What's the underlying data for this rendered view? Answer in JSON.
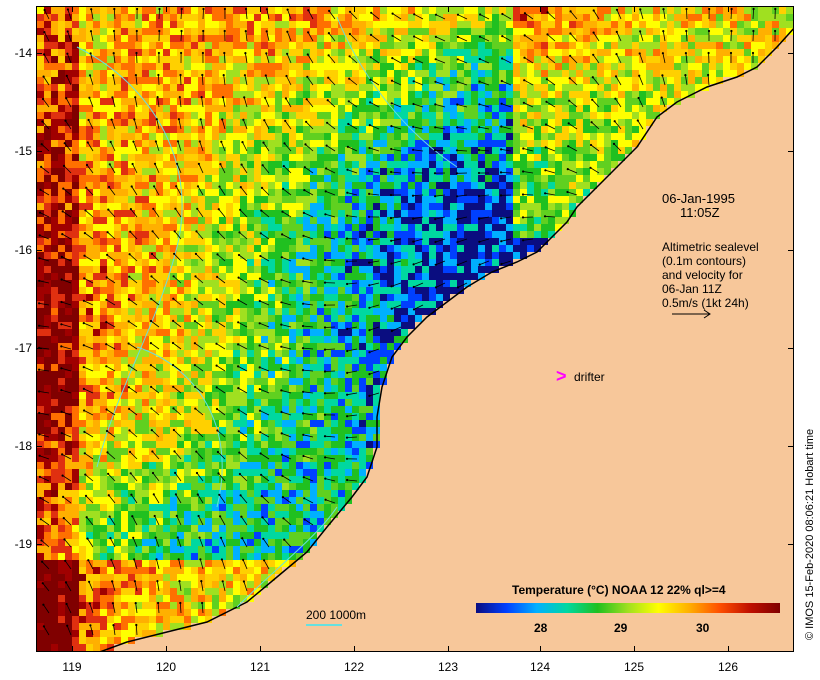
{
  "map": {
    "lat_ticks": [
      "-14",
      "-15",
      "-16",
      "-17",
      "-18",
      "-19"
    ],
    "lon_ticks": [
      "119",
      "120",
      "121",
      "122",
      "123",
      "124",
      "125",
      "126"
    ]
  },
  "annotations": {
    "date": "06-Jan-1995",
    "time": "11:05Z",
    "altimetry_lines": [
      "Altimetric sealevel",
      "(0.1m contours)",
      "and velocity for",
      "06-Jan 11Z",
      "0.5m/s (1kt 24h)"
    ],
    "drifter_label": "drifter",
    "drifter_symbol": ">"
  },
  "colorbar": {
    "title": "Temperature (°C) NOAA 12 22% ql>=4",
    "ticks": [
      "28",
      "29",
      "30"
    ],
    "colors": [
      "#0a0d80",
      "#0040ff",
      "#00b0ff",
      "#20c020",
      "#ffff00",
      "#ff5000",
      "#800000"
    ]
  },
  "contour_legend": "200  1000m",
  "credit": "© IMOS 15-Feb-2020 08:06:21 Hobart time",
  "colors": {
    "land": "#f7c79a",
    "contour": "#66e0e0",
    "drifter": "#ff00ff"
  }
}
